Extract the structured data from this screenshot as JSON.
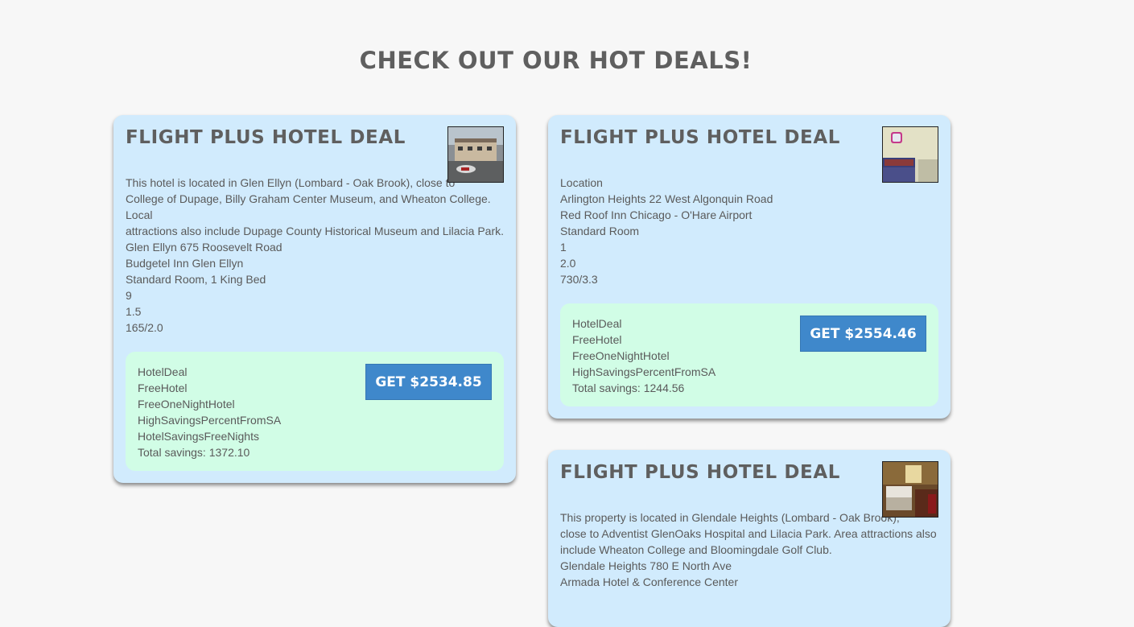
{
  "page": {
    "heading": "CHECK OUT OUR HOT DEALS!"
  },
  "deals": [
    {
      "title": "FLIGHT PLUS HOTEL DEAL",
      "image_icon": "hotel-exterior-photo",
      "details": [
        "This hotel is located in Glen Ellyn (Lombard - Oak Brook), close to",
        "College of Dupage, Billy Graham Center Museum, and Wheaton College. Local",
        "attractions also include Dupage County Historical Museum and Lilacia Park.",
        "Glen Ellyn 675 Roosevelt Road",
        "Budgetel Inn Glen Ellyn",
        "Standard Room, 1 King Bed",
        "9",
        "1.5",
        "165/2.0"
      ],
      "tags": [
        "HotelDeal",
        "FreeHotel",
        "FreeOneNightHotel",
        "HighSavingsPercentFromSA",
        "HotelSavingsFreeNights"
      ],
      "savings": "Total savings: 1372.10",
      "button_label": "GET $2534.85"
    },
    {
      "title": "FLIGHT PLUS HOTEL DEAL",
      "image_icon": "hotel-room-photo",
      "details": [
        "Location",
        "Arlington Heights 22 West Algonquin Road",
        "Red Roof Inn Chicago - O'Hare Airport",
        "Standard Room",
        "1",
        "2.0",
        "730/3.3"
      ],
      "tags": [
        "HotelDeal",
        "FreeHotel",
        "FreeOneNightHotel",
        "HighSavingsPercentFromSA"
      ],
      "savings": "Total savings: 1244.56",
      "button_label": "GET $2554.46"
    },
    {
      "title": "FLIGHT PLUS HOTEL DEAL",
      "image_icon": "hotel-room-photo",
      "details": [
        "This property is located in Glendale Heights (Lombard - Oak Brook),",
        "close to Adventist GlenOaks Hospital and Lilacia Park. Area attractions also",
        "include Wheaton College and Bloomingdale Golf Club.",
        "Glendale Heights 780 E North Ave",
        "Armada Hotel & Conference Center"
      ]
    }
  ]
}
